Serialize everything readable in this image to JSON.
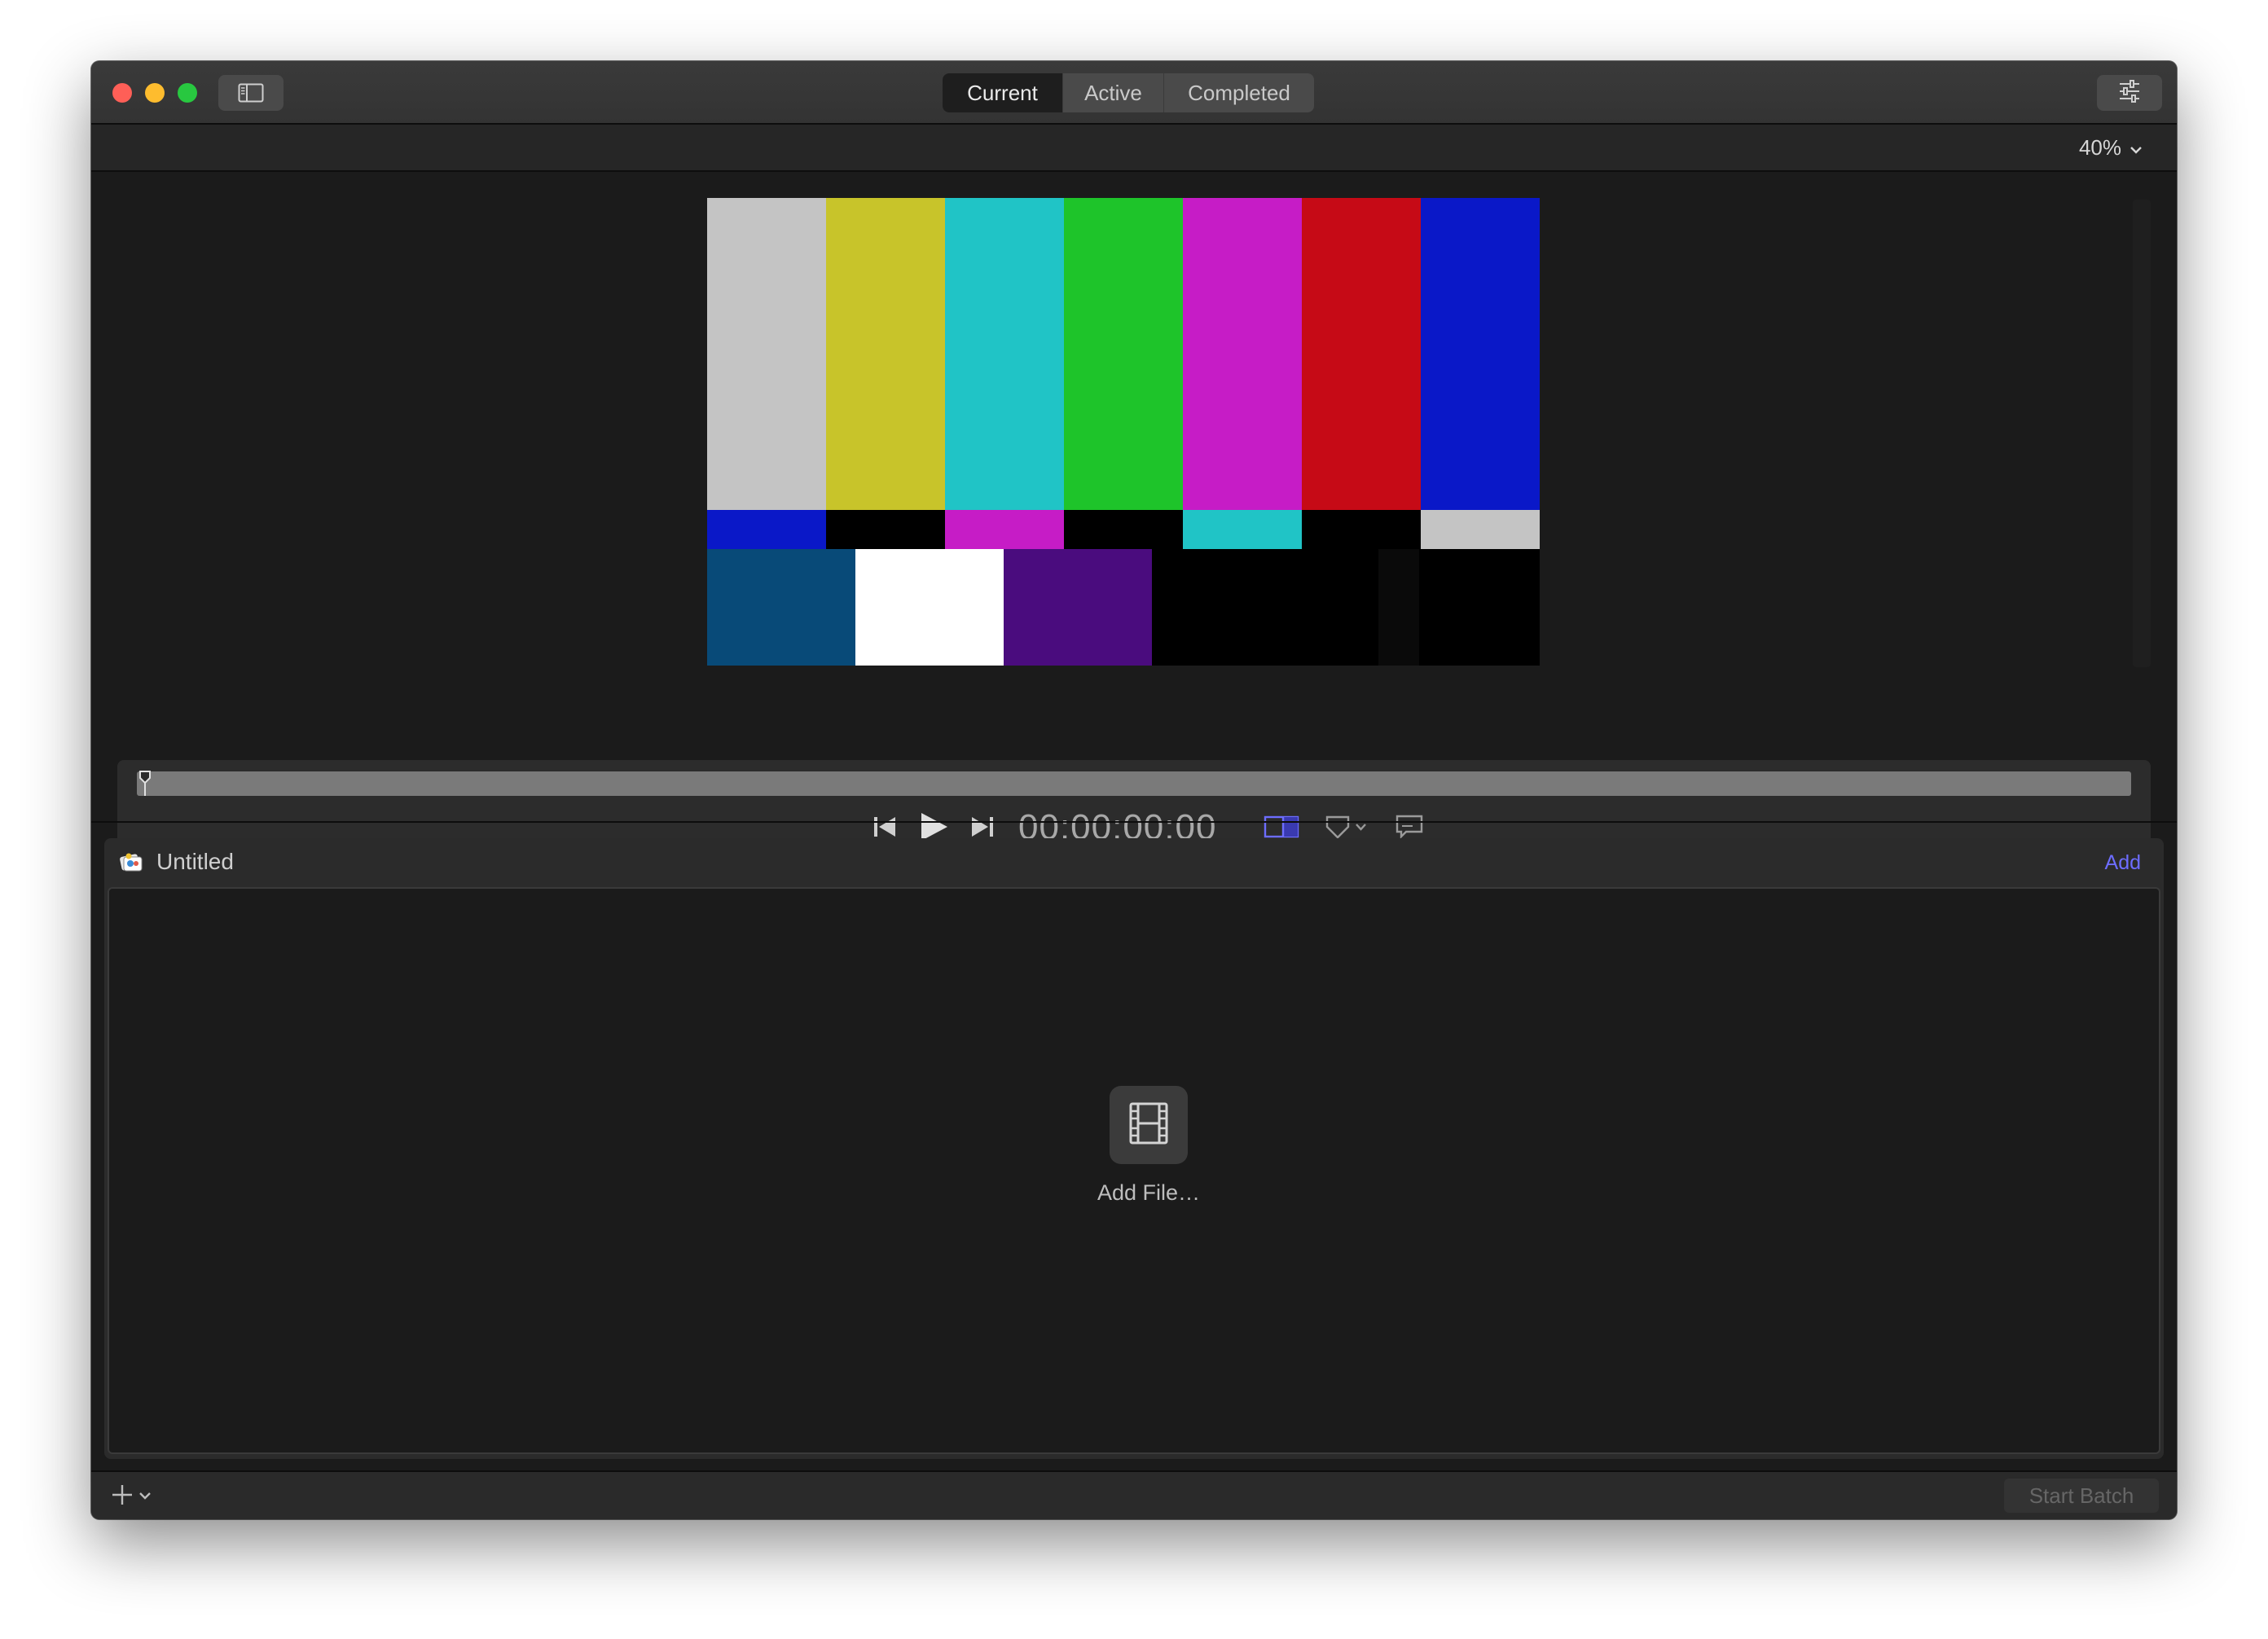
{
  "window": {
    "tabs": [
      {
        "label": "Current",
        "active": true
      },
      {
        "label": "Active",
        "active": false
      },
      {
        "label": "Completed",
        "active": false
      }
    ]
  },
  "toolbar": {
    "zoom_level": "40%"
  },
  "viewer": {
    "color_bars": {
      "top": [
        "#c4c4c4",
        "#c8c42a",
        "#20c4c6",
        "#1ec42a",
        "#c61cc6",
        "#c60a16",
        "#0a18c8"
      ],
      "middle": [
        "#0a18c8",
        "#000000",
        "#c61cc6",
        "#000000",
        "#20c4c6",
        "#000000",
        "#c4c4c4"
      ],
      "bottom": [
        "#084a78",
        "#ffffff",
        "#4a0c7e",
        "#000000",
        "#000000",
        "#0a0a0a",
        "#000000"
      ]
    },
    "timecode": "00:00:00;00"
  },
  "batch": {
    "title": "Untitled",
    "add_label": "Add",
    "add_file_label": "Add File…"
  },
  "footer": {
    "start_batch_label": "Start Batch"
  },
  "colors": {
    "accent": "#6d6dff",
    "window_bg": "#1b1b1b"
  }
}
